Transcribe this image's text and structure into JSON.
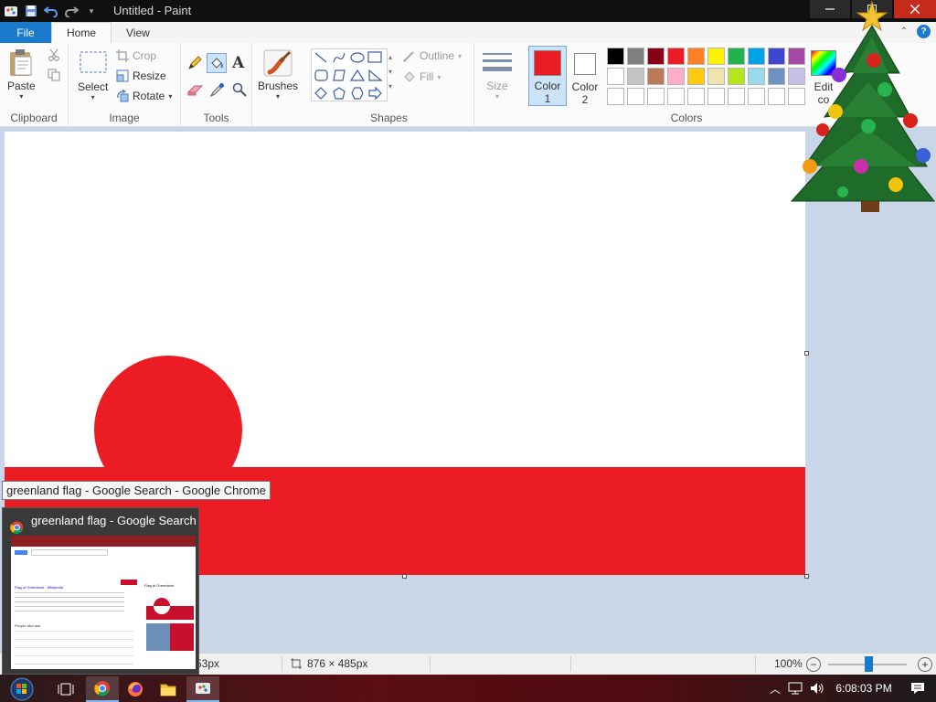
{
  "window": {
    "title": "Untitled - Paint",
    "controls": {
      "minimize": "minimize",
      "maximize": "maximize",
      "close": "close"
    }
  },
  "quick_access": [
    "paint-app-icon",
    "save-icon",
    "undo-icon",
    "redo-icon",
    "customize-icon"
  ],
  "tabs": [
    {
      "label": "File"
    },
    {
      "label": "Home"
    },
    {
      "label": "View"
    }
  ],
  "ribbon": {
    "clipboard": {
      "label": "Clipboard",
      "paste": "Paste"
    },
    "image": {
      "label": "Image",
      "select": "Select",
      "crop": "Crop",
      "resize": "Resize",
      "rotate": "Rotate"
    },
    "tools": {
      "label": "Tools"
    },
    "brushes": {
      "label": "Brushes"
    },
    "shapes": {
      "label": "Shapes",
      "outline": "Outline",
      "fill": "Fill"
    },
    "size": {
      "label": "Size"
    },
    "color1": {
      "label": "Color",
      "number": "1",
      "value": "#ec1c24"
    },
    "color2": {
      "label": "Color",
      "number": "2",
      "value": "#ffffff"
    },
    "colors": {
      "label": "Colors",
      "edit_label": "Edit",
      "edit_label_2": "co",
      "row1": [
        "#000000",
        "#7f7f7f",
        "#880015",
        "#ed1c24",
        "#ff7f27",
        "#fff200",
        "#22b14c",
        "#00a2e8",
        "#3f48cc",
        "#a349a4"
      ],
      "row2": [
        "#ffffff",
        "#c3c3c3",
        "#b97a57",
        "#ffaec9",
        "#ffc90e",
        "#efe4b0",
        "#b5e61d",
        "#99d9ea",
        "#7092be",
        "#c8bfe7"
      ],
      "row3": [
        "#ffffff",
        "#ffffff",
        "#ffffff",
        "#ffffff",
        "#ffffff",
        "#ffffff",
        "#ffffff",
        "#ffffff",
        "#ffffff",
        "#ffffff"
      ]
    }
  },
  "canvas": {
    "flag_colors": {
      "white": "#ffffff",
      "red": "#ec1c24"
    }
  },
  "statusbar": {
    "cursor_pos": "53px",
    "canvas_size": "876 × 485px",
    "zoom": "100%"
  },
  "tooltip": "greenland flag - Google Search - Google Chrome",
  "thumbnail": {
    "title": "greenland flag - Google Search ...",
    "search_result_title": "Flag of Greenland - Wikipedia",
    "kp_title": "Flag of Greenland",
    "people_also_ask": "People also ask"
  },
  "taskbar": {
    "apps": [
      "start-button",
      "task-view",
      "chrome",
      "firefox",
      "file-explorer",
      "paint"
    ],
    "clock": "6:08:03 PM"
  }
}
